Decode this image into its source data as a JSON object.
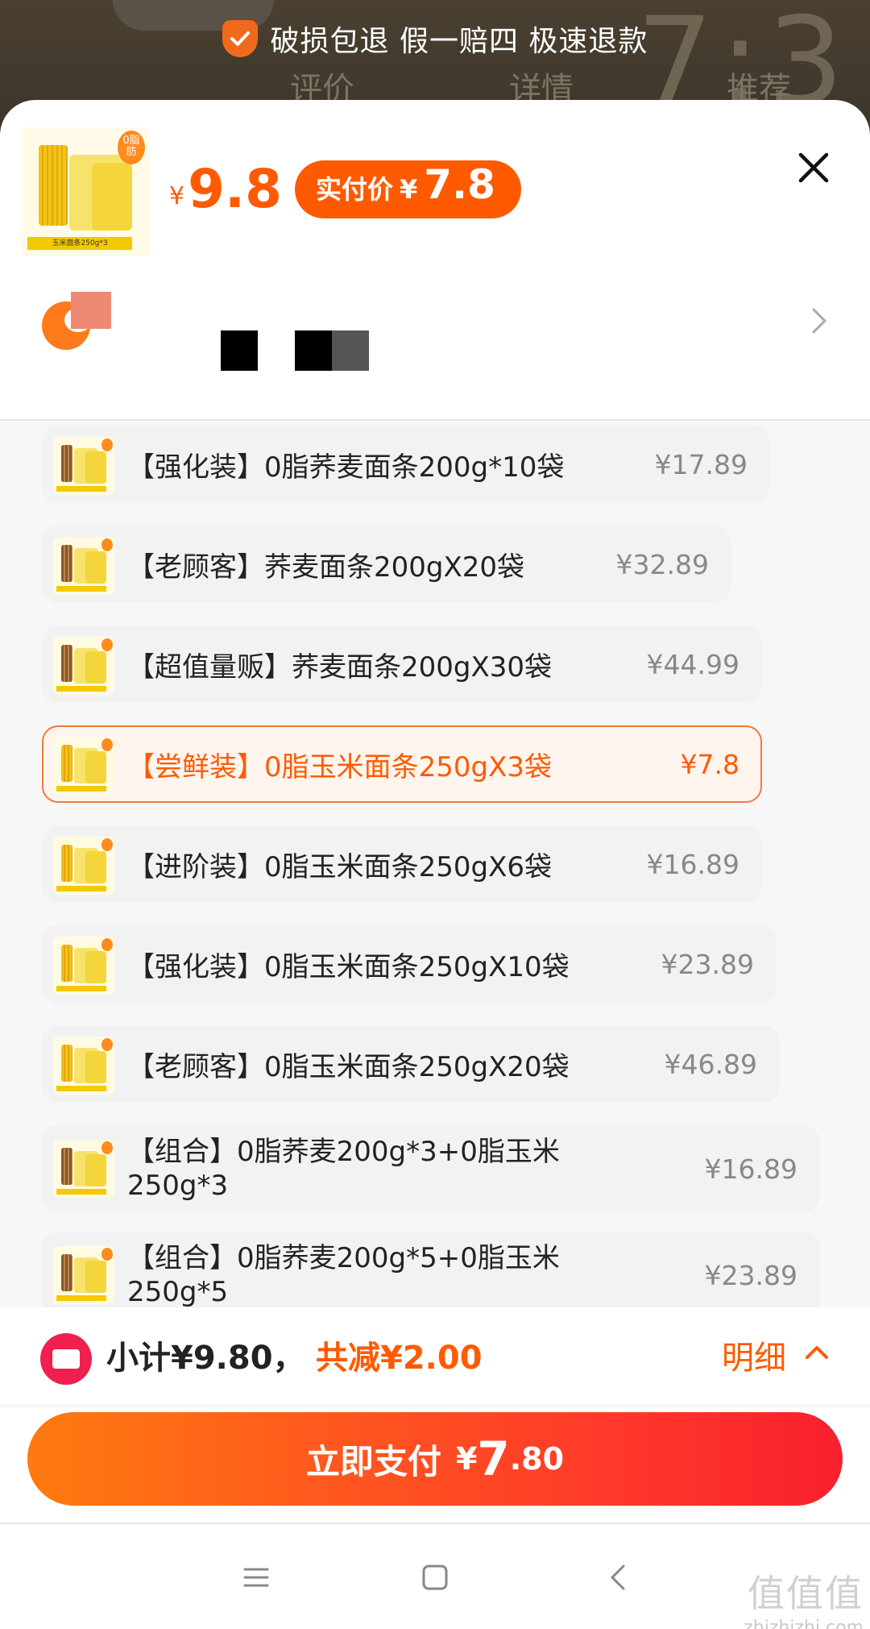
{
  "background": {
    "guarantee_text": "破损包退 假一赔四 极速退款",
    "tabs": [
      "评价",
      "详情",
      "推荐"
    ],
    "big_digits": "7:3"
  },
  "product": {
    "price_yen": "¥",
    "price": "9.8",
    "paid_label": "实付价",
    "paid_yen": "¥",
    "paid_value": "7.8",
    "thumb_caption": "玉米面条250g*3",
    "thumb_badge": "0脂肪"
  },
  "options": [
    {
      "label": "【强化装】0脂荞麦面条200g*10袋",
      "price": "¥17.89",
      "kind": "buckwheat",
      "selected": false
    },
    {
      "label": "【老顾客】荞麦面条200gX20袋",
      "price": "¥32.89",
      "kind": "buckwheat",
      "selected": false
    },
    {
      "label": "【超值量贩】荞麦面条200gX30袋",
      "price": "¥44.99",
      "kind": "buckwheat",
      "selected": false
    },
    {
      "label": "【尝鲜装】0脂玉米面条250gX3袋",
      "price": "¥7.8",
      "kind": "corn",
      "selected": true
    },
    {
      "label": "【进阶装】0脂玉米面条250gX6袋",
      "price": "¥16.89",
      "kind": "corn",
      "selected": false
    },
    {
      "label": "【强化装】0脂玉米面条250gX10袋",
      "price": "¥23.89",
      "kind": "corn",
      "selected": false
    },
    {
      "label": "【老顾客】0脂玉米面条250gX20袋",
      "price": "¥46.89",
      "kind": "corn",
      "selected": false
    },
    {
      "label": "【组合】0脂荞麦200g*3+0脂玉米250g*3",
      "price": "¥16.89",
      "kind": "combo",
      "selected": false
    },
    {
      "label": "【组合】0脂荞麦200g*5+0脂玉米250g*5",
      "price": "¥23.89",
      "kind": "combo",
      "selected": false
    }
  ],
  "summary": {
    "subtotal": "小计¥9.80，",
    "discount": "共减¥2.00",
    "detail": "明细"
  },
  "pay": {
    "label": "立即支付",
    "yen": "¥",
    "int": "7",
    "dec": ".80"
  },
  "watermark": {
    "big": "值值值",
    "small": "zhizhizhi.com"
  },
  "colors": {
    "accent": "#ff5a00",
    "pay_gradient_start": "#ff7a10",
    "pay_gradient_end": "#f8202e",
    "selected_border": "#f07a3a"
  },
  "icons": [
    "shield-check-icon",
    "close-icon",
    "chevron-right-icon",
    "coupon-icon",
    "chevron-up-icon",
    "menu-icon",
    "home-square-icon",
    "back-icon"
  ]
}
